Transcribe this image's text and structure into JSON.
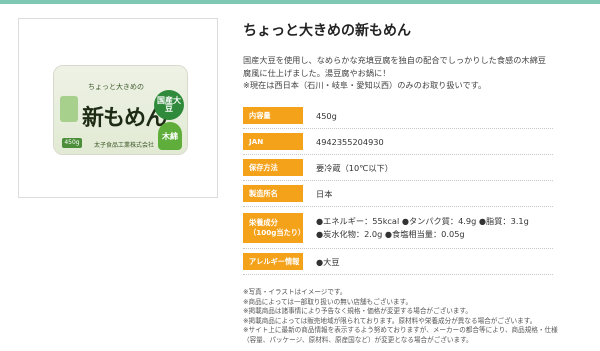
{
  "product": {
    "title": "ちょっと大きめの新もめん",
    "description": [
      "国産大豆を使用し、なめらかな充填豆腐を独自の配合でしっかりした食感の木綿豆",
      "腐風に仕上げました。湯豆腐やお鍋に！",
      "※現在は西日本（石川・岐阜・愛知以西）のみのお取り扱いです。"
    ],
    "package": {
      "brand_text": "ちょっと大きめの",
      "name_text": "新もめん",
      "seal_text": "国産大豆",
      "leaf_text": "木綿",
      "weight_text": "450g",
      "maker_text": "太子食品工業株式会社"
    }
  },
  "specs": [
    {
      "label": "内容量",
      "value": "450g"
    },
    {
      "label": "JAN",
      "value": "4942355204930"
    },
    {
      "label": "保存方法",
      "value": "要冷蔵（10℃以下）"
    },
    {
      "label": "製造所名",
      "value": "日本"
    },
    {
      "label_line1": "栄養成分",
      "label_line2": "（100g当たり）",
      "value_line1": "●エネルギー：55kcal ●タンパク質：4.9g ●脂質：3.1g",
      "value_line2": "●炭水化物：2.0g ●食塩相当量：0.05g"
    },
    {
      "label": "アレルギー情報",
      "value": "●大豆"
    }
  ],
  "notes": [
    "※写真・イラストはイメージです。",
    "※商品によっては一部取り扱いの無い店舗もございます。",
    "※掲載商品は諸事情により予告なく規格・価格が変更する場合がございます。",
    "※掲載商品によっては販売地域が限られております。原材料や栄養成分が異なる場合がございます。",
    "※サイト上に最新の商品情報を表示するよう努めておりますが、メーカーの都合等により、商品規格・仕様",
    "（容量、パッケージ、原材料、原産国など）が変更となる場合がございます。"
  ],
  "colors": {
    "accent_bar": "#7ec8b4",
    "label_bg": "#f5a21b"
  }
}
